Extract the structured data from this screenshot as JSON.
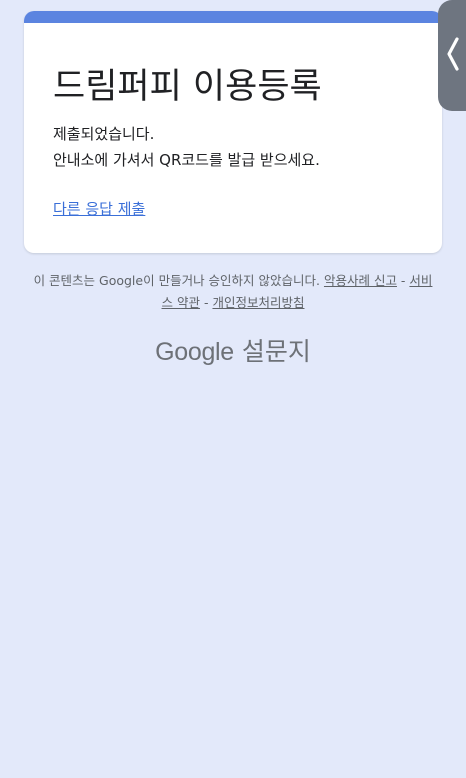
{
  "form": {
    "title": "드림퍼피 이용등록",
    "confirmation_line1": "제출되었습니다.",
    "confirmation_line2": "안내소에 가셔서 QR코드를 발급 받으세요.",
    "resubmit_link": "다른 응답 제출"
  },
  "footer": {
    "disclaimer": "이 콘텐츠는 Google이 만들거나 승인하지 않았습니다.",
    "report_abuse_link": "악용사례 신고",
    "separator1": " - ",
    "terms_link": "서비스 약관",
    "separator2": " - ",
    "privacy_link": "개인정보처리방침"
  },
  "branding": {
    "google": "Google",
    "product": "설문지"
  },
  "edge_panel": {
    "icon": "chevron-left-icon"
  },
  "colors": {
    "page_background": "#e3e9fa",
    "card_accent": "#5b84e0",
    "link": "#3a6fd8",
    "edge_tab": "#6e7580"
  }
}
